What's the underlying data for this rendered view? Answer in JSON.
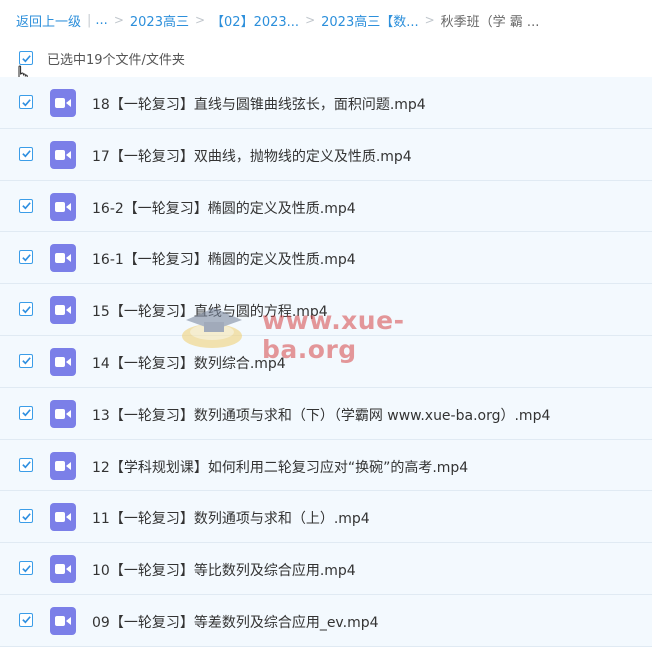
{
  "breadcrumb": {
    "back": "返回上一级",
    "ellipsis": "...",
    "items": [
      "2023高三",
      "【02】2023...",
      "2023高三【数...",
      "秋季班（学 霸 ..."
    ]
  },
  "selection": {
    "label": "已选中19个文件/文件夹"
  },
  "files": [
    "18【一轮复习】直线与圆锥曲线弦长，面积问题.mp4",
    "17【一轮复习】双曲线，抛物线的定义及性质.mp4",
    "16-2【一轮复习】椭圆的定义及性质.mp4",
    "16-1【一轮复习】椭圆的定义及性质.mp4",
    "15【一轮复习】直线与圆的方程.mp4",
    "14【一轮复习】数列综合.mp4",
    "13【一轮复习】数列通项与求和（下）（学霸网 www.xue-ba.org）.mp4",
    "12【学科规划课】如何利用二轮复习应对“换碗”的高考.mp4",
    "11【一轮复习】数列通项与求和（上）.mp4",
    "10【一轮复习】等比数列及综合应用.mp4",
    "09【一轮复习】等差数列及综合应用_ev.mp4"
  ],
  "watermark": {
    "text": "www.xue-ba.org"
  },
  "colors": {
    "link": "#2c8fdb",
    "row_bg": "#f3f9fe",
    "video_icon": "#7b7fe8",
    "checkbox": "#3b9de8"
  },
  "icons": {
    "file": "video-file-icon",
    "check": "checkbox-checked-icon",
    "cursor": "hand-pointer-icon"
  }
}
